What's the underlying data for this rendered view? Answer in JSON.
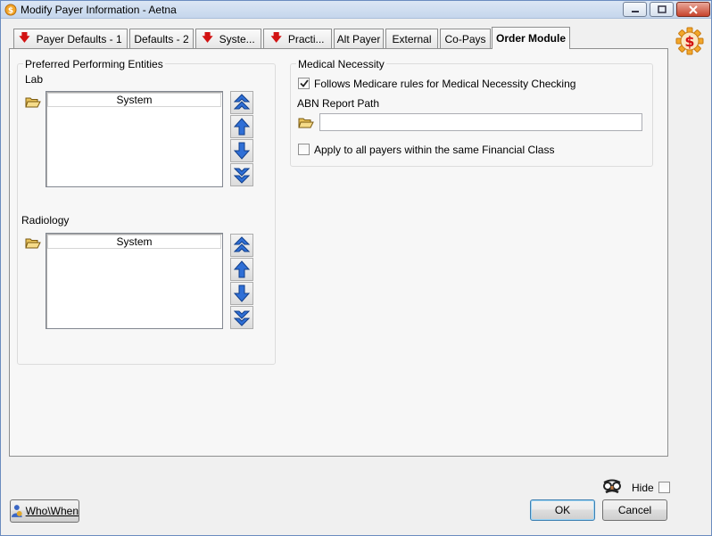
{
  "window": {
    "title": "Modify Payer Information - Aetna"
  },
  "tabs": [
    {
      "label": "Payer Defaults - 1",
      "flag": true
    },
    {
      "label": "Defaults - 2",
      "flag": false
    },
    {
      "label": "Syste...",
      "flag": true
    },
    {
      "label": "Practi...",
      "flag": true
    },
    {
      "label": "Alt Payer",
      "flag": false
    },
    {
      "label": "External",
      "flag": false
    },
    {
      "label": "Co-Pays",
      "flag": false
    },
    {
      "label": "Order Module",
      "flag": false,
      "active": true
    }
  ],
  "preferred": {
    "title": "Preferred Performing Entities",
    "lab": {
      "label": "Lab",
      "column": "System"
    },
    "radiology": {
      "label": "Radiology",
      "column": "System"
    }
  },
  "medical": {
    "title": "Medical Necessity",
    "follows_medicare": {
      "label": "Follows Medicare rules for Medical Necessity Checking",
      "checked": true
    },
    "abn_label": "ABN Report Path",
    "abn_value": "",
    "apply_all": {
      "label": "Apply to all payers within the same Financial Class",
      "checked": false
    }
  },
  "footer": {
    "who_when": "Who\\When",
    "hide_label": "Hide",
    "ok": "OK",
    "cancel": "Cancel"
  },
  "colors": {
    "flag_red": "#d21313",
    "move_blue": "#2f6fd6"
  }
}
